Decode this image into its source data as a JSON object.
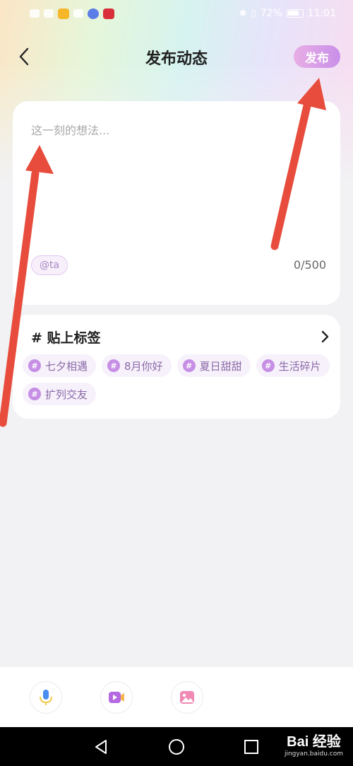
{
  "status_bar": {
    "battery_percent": "72%",
    "time": "11:01"
  },
  "header": {
    "back_icon": "chevron-left-icon",
    "title": "发布动态",
    "publish_label": "发布"
  },
  "compose": {
    "placeholder": "这一刻的想法...",
    "value": "",
    "mention_label": "@ta",
    "char_count": "0/500"
  },
  "tags": {
    "title": "# 贴上标签",
    "items": [
      {
        "label": "七夕相遇"
      },
      {
        "label": "8月你好"
      },
      {
        "label": "夏日甜甜"
      },
      {
        "label": "生活碎片"
      },
      {
        "label": "扩列交友"
      }
    ]
  },
  "toolbar": {
    "items": [
      {
        "icon": "microphone-icon"
      },
      {
        "icon": "video-icon"
      },
      {
        "icon": "image-icon"
      }
    ]
  },
  "watermark": {
    "main": "Bai 经验",
    "sub": "jingyan.baidu.com"
  },
  "colors": {
    "accent": "#c98fe9",
    "arrow": "#e74c3c",
    "background": "#f2f2f4"
  }
}
